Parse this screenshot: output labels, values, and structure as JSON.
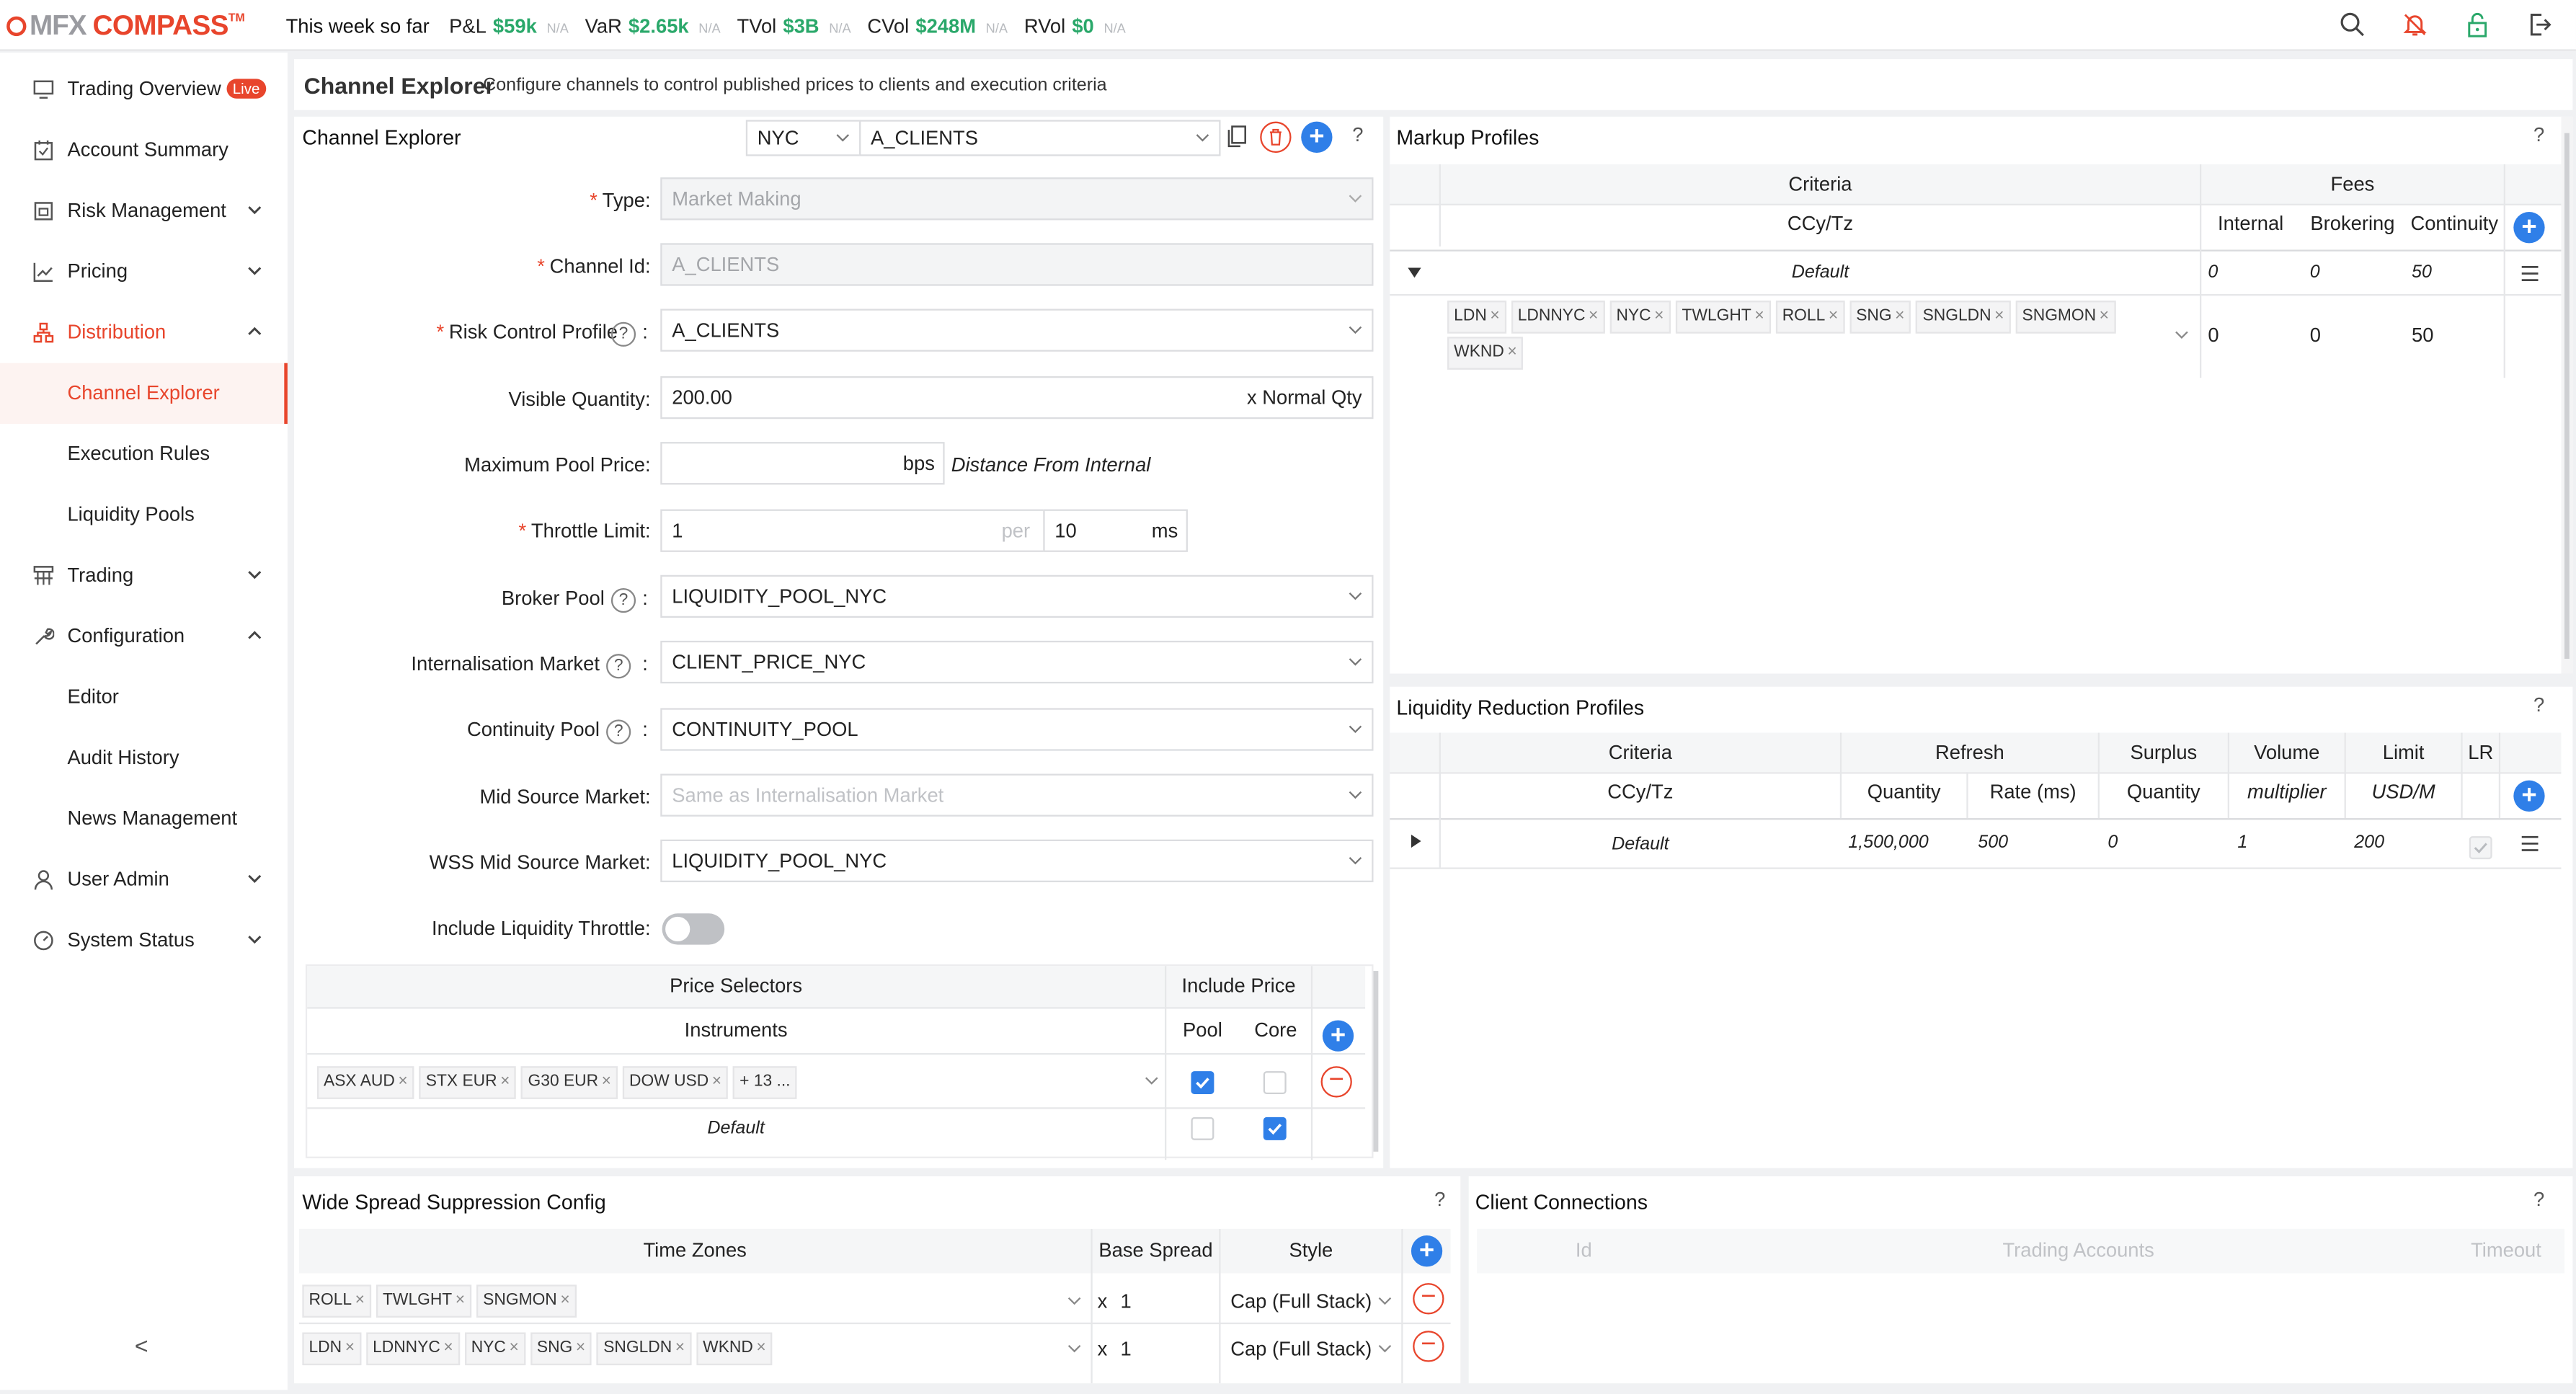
{
  "app": {
    "logo_mfx": "MFX",
    "logo_compass": "COMPASS",
    "logo_tm": "TM"
  },
  "topbar": {
    "period": "This week so far",
    "metrics": [
      {
        "label": "P&L",
        "value": "$59k",
        "na": "N/A"
      },
      {
        "label": "VaR",
        "value": "$2.65k",
        "na": "N/A"
      },
      {
        "label": "TVol",
        "value": "$3B",
        "na": "N/A"
      },
      {
        "label": "CVol",
        "value": "$248M",
        "na": "N/A"
      },
      {
        "label": "RVol",
        "value": "$0",
        "na": "N/A"
      }
    ],
    "icons": [
      "search-icon",
      "bell-icon",
      "lock-icon",
      "logout-icon"
    ]
  },
  "sidebar": {
    "items": [
      {
        "label": "Trading Overview",
        "badge": "Live",
        "icon": "monitor-icon"
      },
      {
        "label": "Account Summary",
        "icon": "calendar-icon"
      },
      {
        "label": "Risk Management",
        "icon": "window-icon"
      },
      {
        "label": "Pricing",
        "icon": "chart-icon"
      },
      {
        "label": "Distribution",
        "icon": "network-icon"
      },
      {
        "label": "Channel Explorer"
      },
      {
        "label": "Execution Rules"
      },
      {
        "label": "Liquidity Pools"
      },
      {
        "label": "Trading",
        "icon": "sitemap-icon"
      },
      {
        "label": "Configuration",
        "icon": "wrench-icon"
      },
      {
        "label": "Editor"
      },
      {
        "label": "Audit History"
      },
      {
        "label": "News Management"
      },
      {
        "label": "User Admin",
        "icon": "user-icon"
      },
      {
        "label": "System Status",
        "icon": "dashboard-icon"
      }
    ],
    "collapse": "<"
  },
  "page": {
    "title": "Channel Explorer",
    "subtitle": "Configure channels to control published prices to clients and execution criteria"
  },
  "channel": {
    "title": "Channel Explorer",
    "location": "NYC",
    "channel": "A_CLIENTS",
    "help": "?",
    "fields": {
      "type_label": "Type:",
      "type_value": "Market Making",
      "channel_id_label": "Channel Id:",
      "channel_id_value": "A_CLIENTS",
      "risk_label": "Risk Control Profile",
      "risk_value": "A_CLIENTS",
      "visible_label": "Visible Quantity:",
      "visible_value": "200.00",
      "visible_suffix": "x Normal Qty",
      "maxpool_label": "Maximum Pool Price:",
      "maxpool_value": "",
      "maxpool_unit": "bps",
      "maxpool_note": "Distance From Internal",
      "throttle_label": "Throttle Limit:",
      "throttle_value": "1",
      "throttle_per": "per",
      "throttle_ms_value": "10",
      "throttle_ms": "ms",
      "broker_label": "Broker Pool",
      "broker_value": "LIQUIDITY_POOL_NYC",
      "intern_label": "Internalisation Market",
      "intern_value": "CLIENT_PRICE_NYC",
      "cont_label": "Continuity Pool",
      "cont_value": "CONTINUITY_POOL",
      "mid_label": "Mid Source Market:",
      "mid_placeholder": "Same as Internalisation Market",
      "wss_label": "WSS Mid Source Market:",
      "wss_value": "LIQUIDITY_POOL_NYC",
      "liq_throttle_label": "Include Liquidity Throttle:",
      "colon": ":"
    },
    "price_selectors": {
      "header_left": "Price Selectors",
      "header_right": "Include Price",
      "sub_instruments": "Instruments",
      "sub_pool": "Pool",
      "sub_core": "Core",
      "row1_tags": [
        "ASX AUD",
        "STX EUR",
        "G30 EUR",
        "DOW USD"
      ],
      "row1_more": "+ 13 ...",
      "row2_label": "Default"
    }
  },
  "markup": {
    "title": "Markup Profiles",
    "help": "?",
    "h_criteria": "Criteria",
    "h_fees": "Fees",
    "h_ccy": "CCy/Tz",
    "h_internal": "Internal",
    "h_brokering": "Brokering",
    "h_continuity": "Continuity",
    "default_row": {
      "label": "Default",
      "internal": "0",
      "brokering": "0",
      "continuity": "50"
    },
    "sub_tags": [
      "LDN",
      "LDNNYC",
      "NYC",
      "TWLGHT",
      "ROLL",
      "SNG",
      "SNGLDN",
      "SNGMON",
      "WKND"
    ],
    "sub_row": {
      "internal": "0",
      "brokering": "0",
      "continuity": "50"
    }
  },
  "lr": {
    "title": "Liquidity Reduction Profiles",
    "help": "?",
    "h_criteria": "Criteria",
    "h_refresh": "Refresh",
    "h_surplus": "Surplus",
    "h_volume": "Volume",
    "h_limit": "Limit",
    "h_lr": "LR",
    "s_ccy": "CCy/Tz",
    "s_qty": "Quantity",
    "s_rate": "Rate (ms)",
    "s_sqty": "Quantity",
    "s_mult": "multiplier",
    "s_usd": "USD/M",
    "row": {
      "label": "Default",
      "qty": "1,500,000",
      "rate": "500",
      "surplus": "0",
      "volume": "1",
      "limit": "200"
    }
  },
  "wss": {
    "title": "Wide Spread Suppression Config",
    "help": "?",
    "h_tz": "Time Zones",
    "h_base": "Base Spread",
    "h_style": "Style",
    "rows": [
      {
        "tags": [
          "ROLL",
          "TWLGHT",
          "SNGMON"
        ],
        "x": "x",
        "base": "1",
        "style": "Cap (Full Stack)"
      },
      {
        "tags": [
          "LDN",
          "LDNNYC",
          "NYC",
          "SNG",
          "SNGLDN",
          "WKND"
        ],
        "x": "x",
        "base": "1",
        "style": "Cap (Full Stack)"
      }
    ]
  },
  "clients": {
    "title": "Client Connections",
    "help": "?",
    "h_id": "Id",
    "h_accounts": "Trading Accounts",
    "h_timeout": "Timeout"
  },
  "colors": {
    "accent": "#e8452c",
    "positive": "#2aa86a",
    "primary": "#2f7fe8"
  }
}
